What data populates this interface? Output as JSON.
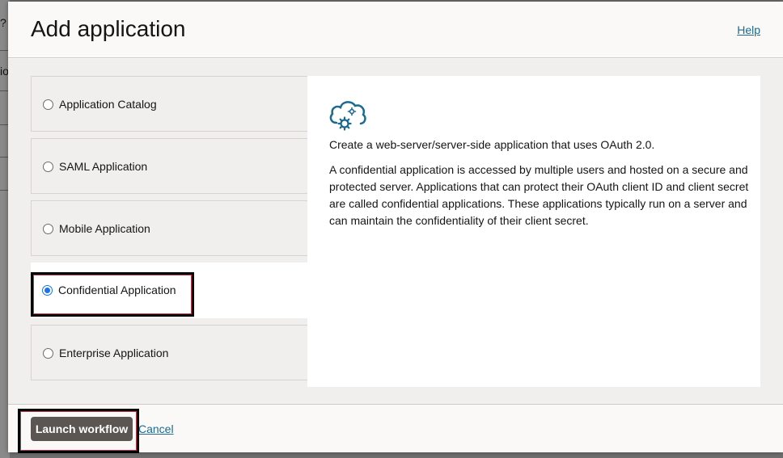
{
  "background": {
    "fragments": [
      "?",
      "io"
    ]
  },
  "dialog": {
    "title": "Add application",
    "help_label": "Help"
  },
  "options": [
    {
      "label": "Application Catalog",
      "selected": false
    },
    {
      "label": "SAML Application",
      "selected": false
    },
    {
      "label": "Mobile Application",
      "selected": false
    },
    {
      "label": "Confidential Application",
      "selected": true
    },
    {
      "label": "Enterprise Application",
      "selected": false
    }
  ],
  "detail": {
    "icon": "cloud-gear-icon",
    "subtitle": "Create a web-server/server-side application that uses OAuth 2.0.",
    "description": "A confidential application is accessed by multiple users and hosted on a secure and protected server. Applications that can protect their OAuth client ID and client secret are called confidential applications. These applications typically run on a server and can maintain the confidentiality of their client secret."
  },
  "footer": {
    "launch_label": "Launch workflow",
    "cancel_label": "Cancel"
  },
  "colors": {
    "accent": "#1b6a8f",
    "button": "#5b5652",
    "radio_selected": "#1a73e8",
    "highlight": "#000000"
  }
}
